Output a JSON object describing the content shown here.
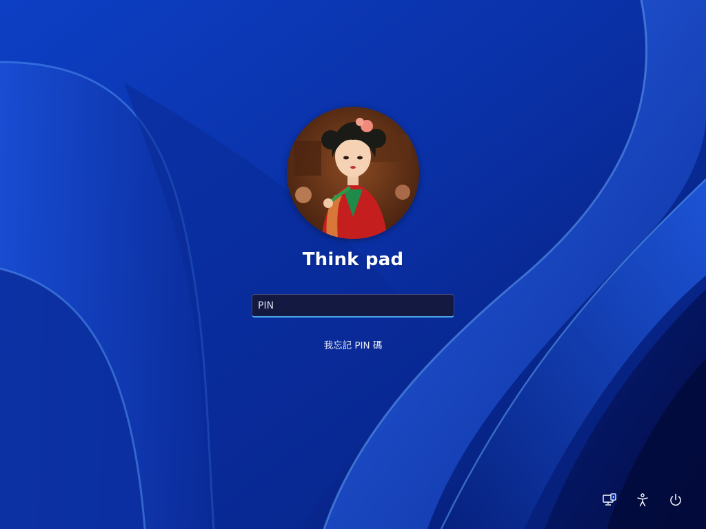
{
  "screen": "lock-screen",
  "user": {
    "name": "Think pad"
  },
  "pin_field": {
    "placeholder": "PIN",
    "value": ""
  },
  "links": {
    "forgot_pin": "我忘記 PIN 碼"
  },
  "bottom_right_controls": [
    {
      "name": "network-icon"
    },
    {
      "name": "accessibility-icon"
    },
    {
      "name": "power-icon"
    }
  ],
  "colors": {
    "background": "#0a2fa8",
    "accent": "#4aa3e8",
    "text": "#ffffff"
  }
}
